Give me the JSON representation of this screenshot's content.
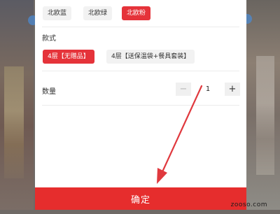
{
  "color_options": {
    "items": [
      {
        "label": "北欧蓝",
        "selected": false
      },
      {
        "label": "北欧绿",
        "selected": false
      },
      {
        "label": "北欧粉",
        "selected": true
      }
    ]
  },
  "style": {
    "label": "款式",
    "items": [
      {
        "label": "4层【无赠品】",
        "selected": true
      },
      {
        "label": "4层【送保温袋+餐具套装】",
        "selected": false
      }
    ]
  },
  "quantity": {
    "label": "数量",
    "minus": "−",
    "value": "1",
    "plus": "+"
  },
  "confirm_label": "确定",
  "watermark": "zooso.com",
  "colors": {
    "accent": "#e5333a",
    "annotation_arrow": "#e0393e"
  }
}
